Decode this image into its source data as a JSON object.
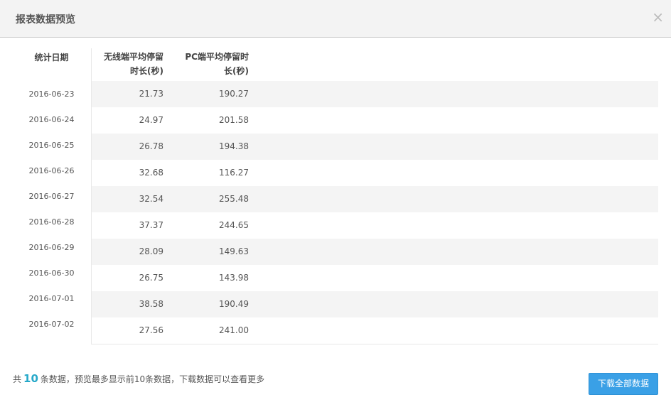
{
  "dialog": {
    "title": "报表数据预览",
    "close_icon": "×"
  },
  "table": {
    "headers": {
      "date": "统计日期",
      "wireless": [
        "无线端平均停留",
        "时长(秒)"
      ],
      "pc": [
        "PC端平均停留时",
        "长(秒)"
      ]
    },
    "rows": [
      {
        "date": "2016-06-23",
        "wireless": "21.73",
        "pc": "190.27"
      },
      {
        "date": "2016-06-24",
        "wireless": "24.97",
        "pc": "201.58"
      },
      {
        "date": "2016-06-25",
        "wireless": "26.78",
        "pc": "194.38"
      },
      {
        "date": "2016-06-26",
        "wireless": "32.68",
        "pc": "116.27"
      },
      {
        "date": "2016-06-27",
        "wireless": "32.54",
        "pc": "255.48"
      },
      {
        "date": "2016-06-28",
        "wireless": "37.37",
        "pc": "244.65"
      },
      {
        "date": "2016-06-29",
        "wireless": "28.09",
        "pc": "149.63"
      },
      {
        "date": "2016-06-30",
        "wireless": "26.75",
        "pc": "143.98"
      },
      {
        "date": "2016-07-01",
        "wireless": "38.58",
        "pc": "190.49"
      },
      {
        "date": "2016-07-02",
        "wireless": "27.56",
        "pc": "241.00"
      }
    ]
  },
  "footer": {
    "prefix": "共",
    "count": "10",
    "suffix": "条数据，预览最多显示前10条数据，下载数据可以查看更多",
    "download_label": "下载全部数据"
  }
}
